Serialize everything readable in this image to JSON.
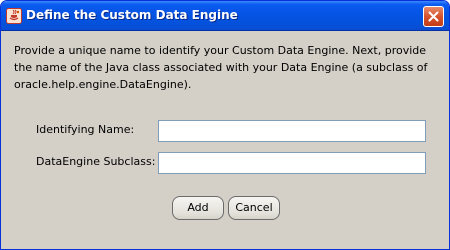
{
  "window": {
    "title": "Define the Custom Data Engine"
  },
  "dialog": {
    "description": "Provide a unique name to identify your Custom Data Engine. Next, provide the name of the Java class associated with your Data Engine (a subclass of oracle.help.engine.DataEngine).",
    "fields": [
      {
        "label": "Identifying Name:",
        "value": ""
      },
      {
        "label": "DataEngine Subclass:",
        "value": ""
      }
    ]
  },
  "buttons": {
    "add_label": "Add",
    "cancel_label": "Cancel"
  },
  "icons": {
    "app": "java-app-icon",
    "close": "close-icon"
  },
  "colors": {
    "titlebar": "#0553e3",
    "window_bg": "#d4d0c8",
    "close_button": "#d6532f"
  }
}
